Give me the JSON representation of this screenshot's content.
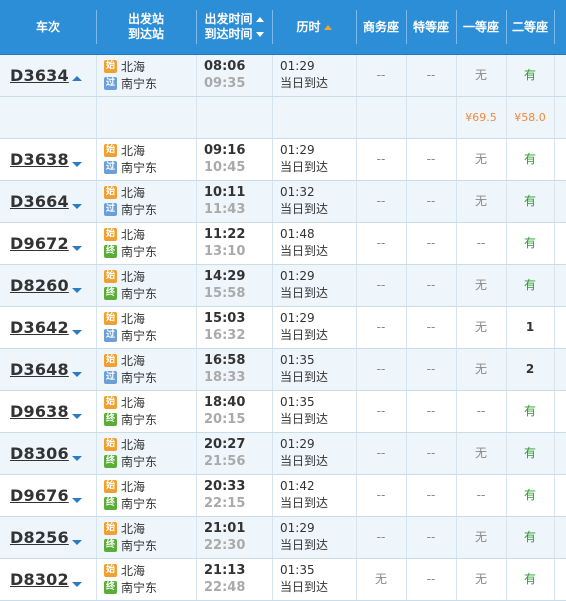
{
  "header": {
    "train_no": "车次",
    "from_station": "出发站",
    "to_station": "到达站",
    "depart_time": "出发时间",
    "arrive_time": "到达时间",
    "duration": "历时",
    "business_seat": "商务座",
    "special_seat": "特等座",
    "first_class": "一等座",
    "second_class": "二等座"
  },
  "badges": {
    "start": "始",
    "pass": "过",
    "end": "终"
  },
  "colors": {
    "header_bg": "#2d8ed8",
    "have_green": "#2b9a2b",
    "price_orange": "#f08a3c"
  },
  "trains": [
    {
      "no": "D3634",
      "from": "北海",
      "from_type": "start",
      "to": "南宁东",
      "to_type": "pass",
      "dep": "08:06",
      "arr": "09:35",
      "dur": "01:29",
      "note": "当日到达",
      "biz": "--",
      "special": "--",
      "first": "无",
      "second": "有",
      "expanded": true
    },
    {
      "no": "D3638",
      "from": "北海",
      "from_type": "start",
      "to": "南宁东",
      "to_type": "pass",
      "dep": "09:16",
      "arr": "10:45",
      "dur": "01:29",
      "note": "当日到达",
      "biz": "--",
      "special": "--",
      "first": "无",
      "second": "有"
    },
    {
      "no": "D3664",
      "from": "北海",
      "from_type": "start",
      "to": "南宁东",
      "to_type": "pass",
      "dep": "10:11",
      "arr": "11:43",
      "dur": "01:32",
      "note": "当日到达",
      "biz": "--",
      "special": "--",
      "first": "无",
      "second": "有"
    },
    {
      "no": "D9672",
      "from": "北海",
      "from_type": "start",
      "to": "南宁东",
      "to_type": "end",
      "dep": "11:22",
      "arr": "13:10",
      "dur": "01:48",
      "note": "当日到达",
      "biz": "--",
      "special": "--",
      "first": "--",
      "second": "有"
    },
    {
      "no": "D8260",
      "from": "北海",
      "from_type": "start",
      "to": "南宁东",
      "to_type": "end",
      "dep": "14:29",
      "arr": "15:58",
      "dur": "01:29",
      "note": "当日到达",
      "biz": "--",
      "special": "--",
      "first": "无",
      "second": "有"
    },
    {
      "no": "D3642",
      "from": "北海",
      "from_type": "start",
      "to": "南宁东",
      "to_type": "pass",
      "dep": "15:03",
      "arr": "16:32",
      "dur": "01:29",
      "note": "当日到达",
      "biz": "--",
      "special": "--",
      "first": "无",
      "second": "1"
    },
    {
      "no": "D3648",
      "from": "北海",
      "from_type": "start",
      "to": "南宁东",
      "to_type": "pass",
      "dep": "16:58",
      "arr": "18:33",
      "dur": "01:35",
      "note": "当日到达",
      "biz": "--",
      "special": "--",
      "first": "无",
      "second": "2"
    },
    {
      "no": "D9638",
      "from": "北海",
      "from_type": "start",
      "to": "南宁东",
      "to_type": "end",
      "dep": "18:40",
      "arr": "20:15",
      "dur": "01:35",
      "note": "当日到达",
      "biz": "--",
      "special": "--",
      "first": "--",
      "second": "有"
    },
    {
      "no": "D8306",
      "from": "北海",
      "from_type": "start",
      "to": "南宁东",
      "to_type": "end",
      "dep": "20:27",
      "arr": "21:56",
      "dur": "01:29",
      "note": "当日到达",
      "biz": "--",
      "special": "--",
      "first": "无",
      "second": "有"
    },
    {
      "no": "D9676",
      "from": "北海",
      "from_type": "start",
      "to": "南宁东",
      "to_type": "end",
      "dep": "20:33",
      "arr": "22:15",
      "dur": "01:42",
      "note": "当日到达",
      "biz": "--",
      "special": "--",
      "first": "--",
      "second": "有"
    },
    {
      "no": "D8256",
      "from": "北海",
      "from_type": "start",
      "to": "南宁东",
      "to_type": "end",
      "dep": "21:01",
      "arr": "22:30",
      "dur": "01:29",
      "note": "当日到达",
      "biz": "--",
      "special": "--",
      "first": "无",
      "second": "有"
    },
    {
      "no": "D8302",
      "from": "北海",
      "from_type": "start",
      "to": "南宁东",
      "to_type": "end",
      "dep": "21:13",
      "arr": "22:48",
      "dur": "01:35",
      "note": "当日到达",
      "biz": "无",
      "special": "--",
      "first": "无",
      "second": "有"
    }
  ],
  "price_row": {
    "first": "¥69.5",
    "second": "¥58.0"
  }
}
